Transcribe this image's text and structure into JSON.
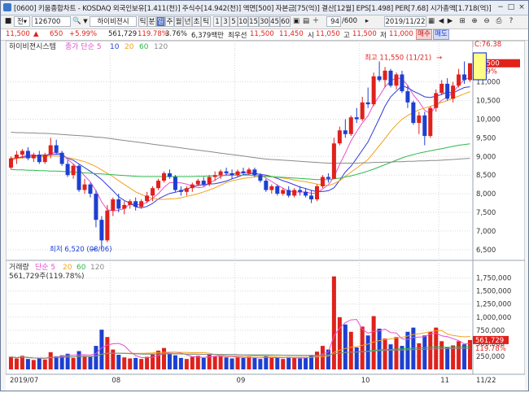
{
  "titlebar": {
    "title": "[0600] 키움종합차트 - KOSDAQ 외국인보유[1.411(천)] 주식수[14.942(천)] 액면[500] 자본금[75(억)] 결산[12월] EPS[1.498] PER[7.68] 시가총액[1.718(억)]",
    "buttons": [
      "−",
      "□",
      "×"
    ]
  },
  "toolbar": {
    "mode": "전",
    "code": "126700",
    "name": "하이비젼시",
    "periods": [
      "틱",
      "분",
      "일",
      "주",
      "월",
      "년",
      "초",
      "틱"
    ],
    "selected_period": "일",
    "intervals": [
      "1",
      "3",
      "5",
      "10",
      "15",
      "30",
      "45",
      "60"
    ],
    "page": "94",
    "page_total": "/600",
    "date": "2019/11/22"
  },
  "infobar": {
    "price": "11,500",
    "change": "650",
    "change_pct": "+5.99%",
    "volume": "561,729",
    "volume_ratio": "119.78%",
    "turnover": "3.76%",
    "trade_amount": "6,379백만",
    "best_label": "최우선",
    "best_price": "11,500",
    "bid": "11,450",
    "open_label": "시",
    "open": "11,050",
    "high_label": "고",
    "high": "11,500",
    "low_label": "저",
    "low": "11,000",
    "buy_button": "매수",
    "sell_button": "매도"
  },
  "price_panel": {
    "legend": [
      "하이비젼시스템",
      "종가 단순 5",
      "10",
      "20",
      "60",
      "120"
    ],
    "legend_colors": [
      "#333333",
      "#e64fd2",
      "#2f3bd6",
      "#f0a41e",
      "#2eb84d",
      "#8a8a8a"
    ],
    "close_label": "C:76.38",
    "price_tag": "11,500",
    "pct_tag": "5.99%",
    "high_note": "최고 11,550 (11/21)",
    "low_note": "최저 6,520 (08/06)",
    "y_ticks": [
      "11,000",
      "10,500",
      "10,000",
      "9,500",
      "9,000",
      "8,500",
      "8,000",
      "7,500",
      "7,000",
      "6,500"
    ]
  },
  "volume_panel": {
    "legend": [
      "거래량",
      "단순 5",
      "20",
      "60",
      "120"
    ],
    "legend_colors": [
      "#333333",
      "#e64fd2",
      "#f0a41e",
      "#2eb84d",
      "#8a8a8a"
    ],
    "value_label": "561,729주(119.78%)",
    "value_tag": "561,729",
    "pct_tag": "119.78%",
    "y_ticks": [
      "1,750,000",
      "1,500,000",
      "1,250,000",
      "1,000,000",
      "750,000",
      "500,000",
      "250,000"
    ]
  },
  "x_axis": {
    "labels": [
      "2019/07",
      "08",
      "09",
      "10",
      "11",
      "11/22"
    ]
  },
  "chart_data": {
    "type": "bar",
    "categories": [
      "2019/07",
      "08",
      "09",
      "10",
      "11",
      "11/22"
    ],
    "ylim": [
      6300,
      11800
    ],
    "candles": [
      [
        8700,
        9000,
        8650,
        8950
      ],
      [
        8950,
        9150,
        8800,
        9050
      ],
      [
        9050,
        9200,
        8950,
        9150
      ],
      [
        9150,
        9250,
        8900,
        8950
      ],
      [
        8950,
        9100,
        8850,
        9050
      ],
      [
        9050,
        9150,
        8800,
        8850
      ],
      [
        8850,
        9100,
        8800,
        9050
      ],
      [
        9050,
        9500,
        8950,
        9300
      ],
      [
        9300,
        9450,
        9050,
        9100
      ],
      [
        9100,
        9150,
        8750,
        8800
      ],
      [
        8800,
        8900,
        8450,
        8500
      ],
      [
        8500,
        8800,
        8400,
        8750
      ],
      [
        8750,
        8800,
        8050,
        8100
      ],
      [
        8100,
        8400,
        8000,
        8250
      ],
      [
        8250,
        8300,
        7900,
        8000
      ],
      [
        8000,
        8100,
        7100,
        7300
      ],
      [
        7300,
        7400,
        6520,
        6750
      ],
      [
        6750,
        7700,
        6700,
        7550
      ],
      [
        7550,
        7900,
        7400,
        7850
      ],
      [
        7850,
        8000,
        7500,
        7600
      ],
      [
        7600,
        7800,
        7450,
        7700
      ],
      [
        7700,
        7850,
        7600,
        7800
      ],
      [
        7800,
        7900,
        7550,
        7650
      ],
      [
        7650,
        7850,
        7600,
        7800
      ],
      [
        7800,
        8050,
        7750,
        7950
      ],
      [
        7950,
        8200,
        7800,
        8150
      ],
      [
        8150,
        8400,
        8100,
        8350
      ],
      [
        8350,
        8600,
        8300,
        8550
      ],
      [
        8550,
        8650,
        8400,
        8450
      ],
      [
        8450,
        8500,
        8050,
        8100
      ],
      [
        8100,
        8200,
        7950,
        8050
      ],
      [
        8050,
        8200,
        7950,
        8150
      ],
      [
        8150,
        8300,
        8050,
        8250
      ],
      [
        8250,
        8400,
        8200,
        8350
      ],
      [
        8350,
        8450,
        8200,
        8250
      ],
      [
        8250,
        8500,
        8200,
        8450
      ],
      [
        8450,
        8600,
        8350,
        8500
      ],
      [
        8500,
        8650,
        8400,
        8600
      ],
      [
        8600,
        8700,
        8500,
        8550
      ],
      [
        8550,
        8650,
        8400,
        8500
      ],
      [
        8500,
        8650,
        8450,
        8600
      ],
      [
        8600,
        8700,
        8500,
        8550
      ],
      [
        8550,
        8700,
        8500,
        8650
      ],
      [
        8650,
        8700,
        8450,
        8500
      ],
      [
        8500,
        8550,
        8300,
        8350
      ],
      [
        8350,
        8400,
        8050,
        8100
      ],
      [
        8100,
        8250,
        8000,
        8200
      ],
      [
        8200,
        8250,
        7950,
        8000
      ],
      [
        8000,
        8150,
        7950,
        8100
      ],
      [
        8100,
        8200,
        7900,
        7950
      ],
      [
        7950,
        8150,
        7900,
        8100
      ],
      [
        8100,
        8200,
        7950,
        8050
      ],
      [
        8050,
        8150,
        7900,
        7950
      ],
      [
        7950,
        8100,
        7750,
        7850
      ],
      [
        7850,
        8250,
        7800,
        8200
      ],
      [
        8200,
        8500,
        8150,
        8450
      ],
      [
        8450,
        8550,
        8300,
        8400
      ],
      [
        8400,
        9500,
        8400,
        9350
      ],
      [
        9350,
        9800,
        9300,
        9700
      ],
      [
        9700,
        10000,
        9500,
        9600
      ],
      [
        9600,
        10100,
        9550,
        10050
      ],
      [
        10050,
        10300,
        9900,
        10000
      ],
      [
        10000,
        10600,
        9950,
        10450
      ],
      [
        10450,
        10850,
        10300,
        10400
      ],
      [
        10400,
        11250,
        10350,
        11150
      ],
      [
        11150,
        11550,
        11000,
        11050
      ],
      [
        11050,
        11400,
        10850,
        11300
      ],
      [
        11300,
        11350,
        10850,
        10900
      ],
      [
        10900,
        11250,
        10800,
        11200
      ],
      [
        11200,
        11300,
        10700,
        10750
      ],
      [
        10750,
        10900,
        10300,
        10450
      ],
      [
        10450,
        10500,
        9850,
        9900
      ],
      [
        9900,
        10200,
        9600,
        10100
      ],
      [
        10100,
        10200,
        9300,
        9550
      ],
      [
        9550,
        10350,
        9500,
        10300
      ],
      [
        10300,
        10800,
        10200,
        10700
      ],
      [
        10700,
        11050,
        10650,
        10950
      ],
      [
        10950,
        11100,
        10500,
        10550
      ],
      [
        10550,
        11000,
        10450,
        10900
      ],
      [
        10900,
        11350,
        10850,
        11200
      ],
      [
        11200,
        11550,
        10950,
        11050
      ],
      [
        11050,
        11500,
        11000,
        11500
      ]
    ],
    "series": [
      {
        "name": "5",
        "values": [
          8900,
          8950,
          9000,
          9050,
          9040,
          9000,
          8990,
          9080,
          9110,
          9050,
          8920,
          8800,
          8650,
          8480,
          8320,
          8080,
          7780,
          7570,
          7540,
          7560,
          7600,
          7730,
          7720,
          7700,
          7770,
          7880,
          8000,
          8170,
          8300,
          8300,
          8290,
          8260,
          8200,
          8160,
          8180,
          8290,
          8360,
          8460,
          8520,
          8530,
          8550,
          8560,
          8590,
          8560,
          8510,
          8420,
          8330,
          8230,
          8150,
          8070,
          8050,
          8040,
          8050,
          8010,
          8020,
          8130,
          8240,
          8450,
          8790,
          9090,
          9420,
          9670,
          9900,
          10090,
          10400,
          10620,
          10870,
          11020,
          11110,
          11080,
          10910,
          10650,
          10470,
          10240,
          10150,
          10350,
          10510,
          10590,
          10720,
          10910,
          11060,
          11120
        ]
      },
      {
        "name": "10",
        "values": [
          8950,
          8960,
          8980,
          9000,
          9010,
          9030,
          9040,
          9050,
          9060,
          9050,
          8950,
          8900,
          8800,
          8700,
          8600,
          8500,
          8380,
          8230,
          8080,
          7920,
          7820,
          7750,
          7650,
          7620,
          7660,
          7740,
          7860,
          7940,
          8010,
          8040,
          8080,
          8130,
          8180,
          8230,
          8240,
          8260,
          8270,
          8300,
          8340,
          8400,
          8450,
          8510,
          8530,
          8540,
          8520,
          8500,
          8460,
          8410,
          8350,
          8300,
          8240,
          8180,
          8140,
          8090,
          8060,
          8060,
          8080,
          8160,
          8360,
          8580,
          8740,
          8950,
          9170,
          9390,
          9700,
          10020,
          10350,
          10600,
          10750,
          10900,
          10840,
          10750,
          10680,
          10600,
          10580,
          10620,
          10660,
          10730,
          10700,
          10780,
          10850,
          10870
        ]
      },
      {
        "name": "20",
        "values": [
          8950,
          8950,
          8960,
          8970,
          8980,
          8990,
          9000,
          9010,
          9010,
          9000,
          8970,
          8940,
          8900,
          8860,
          8800,
          8730,
          8640,
          8550,
          8460,
          8350,
          8250,
          8150,
          8050,
          7980,
          7920,
          7880,
          7850,
          7850,
          7860,
          7870,
          7890,
          7930,
          7960,
          8000,
          8050,
          8100,
          8160,
          8230,
          8300,
          8350,
          8380,
          8410,
          8430,
          8450,
          8460,
          8460,
          8450,
          8440,
          8420,
          8400,
          8370,
          8340,
          8320,
          8290,
          8260,
          8240,
          8220,
          8270,
          8350,
          8470,
          8580,
          8690,
          8800,
          8920,
          9100,
          9290,
          9480,
          9680,
          9850,
          10000,
          10100,
          10180,
          10250,
          10300,
          10340,
          10400,
          10450,
          10500,
          10560,
          10620,
          10680,
          10740
        ]
      },
      {
        "name": "60",
        "values": [
          8650,
          8640,
          8640,
          8630,
          8630,
          8620,
          8620,
          8610,
          8610,
          8600,
          8590,
          8580,
          8570,
          8560,
          8550,
          8540,
          8530,
          8520,
          8510,
          8500,
          8490,
          8480,
          8470,
          8460,
          8460,
          8460,
          8460,
          8460,
          8460,
          8460,
          8460,
          8460,
          8460,
          8470,
          8470,
          8480,
          8480,
          8490,
          8490,
          8500,
          8500,
          8500,
          8500,
          8490,
          8480,
          8470,
          8460,
          8450,
          8440,
          8430,
          8420,
          8410,
          8400,
          8390,
          8380,
          8380,
          8380,
          8400,
          8420,
          8450,
          8480,
          8520,
          8560,
          8610,
          8660,
          8720,
          8780,
          8840,
          8900,
          8960,
          9010,
          9050,
          9090,
          9120,
          9150,
          9180,
          9210,
          9240,
          9270,
          9300,
          9320,
          9340
        ]
      },
      {
        "name": "120",
        "values": [
          9650,
          9640,
          9640,
          9630,
          9630,
          9620,
          9620,
          9610,
          9600,
          9590,
          9580,
          9570,
          9560,
          9550,
          9540,
          9520,
          9510,
          9490,
          9470,
          9450,
          9430,
          9410,
          9390,
          9370,
          9350,
          9330,
          9310,
          9290,
          9270,
          9250,
          9230,
          9210,
          9190,
          9170,
          9150,
          9130,
          9110,
          9090,
          9070,
          9050,
          9030,
          9010,
          8990,
          8970,
          8950,
          8930,
          8920,
          8910,
          8900,
          8890,
          8880,
          8870,
          8860,
          8850,
          8840,
          8830,
          8820,
          8820,
          8820,
          8820,
          8820,
          8820,
          8830,
          8830,
          8840,
          8840,
          8850,
          8850,
          8860,
          8860,
          8870,
          8870,
          8880,
          8880,
          8890,
          8890,
          8900,
          8910,
          8920,
          8930,
          8940,
          8950
        ]
      }
    ],
    "volume": [
      240000,
      210000,
      260000,
      200000,
      180000,
      220000,
      190000,
      330000,
      250000,
      270000,
      300000,
      220000,
      350000,
      260000,
      240000,
      450000,
      760000,
      620000,
      380000,
      280000,
      230000,
      210000,
      220000,
      200000,
      240000,
      300000,
      360000,
      410000,
      300000,
      270000,
      220000,
      200000,
      240000,
      260000,
      220000,
      280000,
      250000,
      260000,
      230000,
      210000,
      230000,
      220000,
      240000,
      220000,
      200000,
      260000,
      220000,
      230000,
      200000,
      240000,
      220000,
      210000,
      230000,
      260000,
      340000,
      450000,
      380000,
      1780000,
      1000000,
      860000,
      720000,
      420000,
      820000,
      650000,
      1020000,
      780000,
      590000,
      480000,
      620000,
      450000,
      720000,
      800000,
      500000,
      650000,
      720000,
      800000,
      540000,
      420000,
      460000,
      540000,
      480000,
      561729
    ],
    "volume_ylim": [
      0,
      1900000
    ]
  }
}
